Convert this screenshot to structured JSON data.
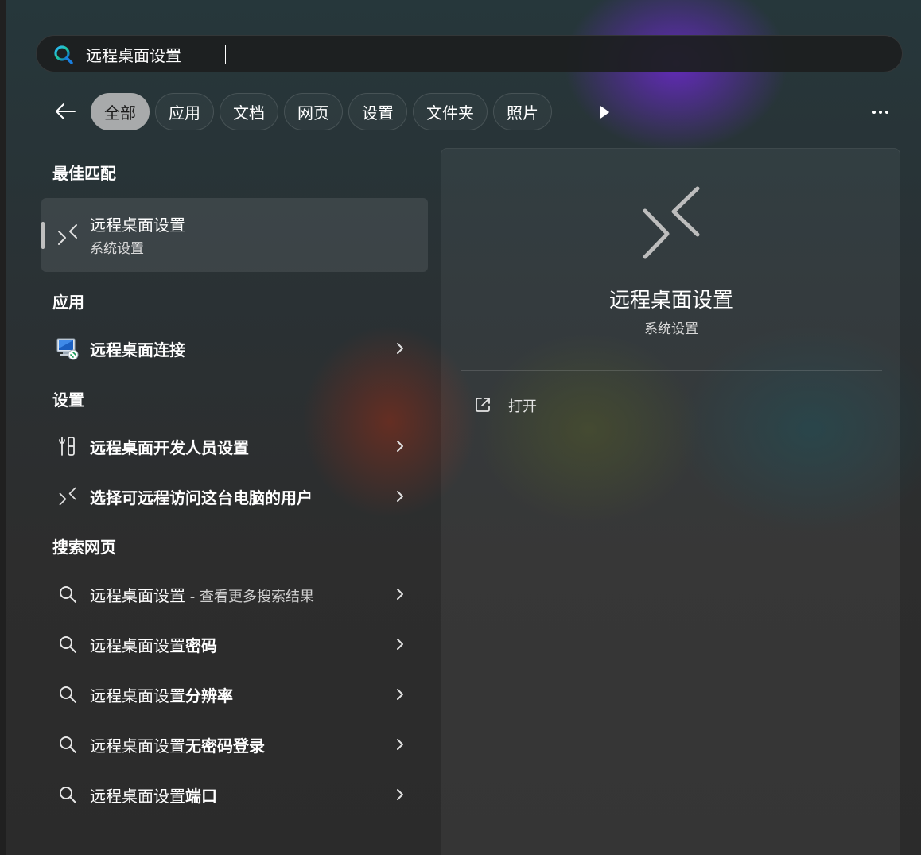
{
  "search": {
    "value": "远程桌面设置",
    "icon": "search-icon"
  },
  "tabs": [
    {
      "label": "全部",
      "active": true
    },
    {
      "label": "应用"
    },
    {
      "label": "文档"
    },
    {
      "label": "网页"
    },
    {
      "label": "设置"
    },
    {
      "label": "文件夹"
    },
    {
      "label": "照片"
    }
  ],
  "nav": {
    "back_icon": "arrow-left-icon",
    "more_tabs_icon": "play-icon",
    "more_icon": "ellipsis-icon"
  },
  "sections": {
    "best_match": "最佳匹配",
    "apps": "应用",
    "settings": "设置",
    "web": "搜索网页"
  },
  "best_match": {
    "title": "远程桌面设置",
    "subtitle": "系统设置",
    "icon": "remote-desktop-icon"
  },
  "apps": [
    {
      "label": "远程桌面连接",
      "icon": "remote-desktop-connection-icon"
    }
  ],
  "settings": [
    {
      "label": "远程桌面开发人员设置",
      "icon": "developer-tools-icon"
    },
    {
      "label": "选择可远程访问这台电脑的用户",
      "icon": "remote-desktop-icon"
    }
  ],
  "web": [
    {
      "prefix": "远程桌面设置",
      "suffix": " - 查看更多搜索结果"
    },
    {
      "prefix": "远程桌面设置",
      "suffix": "密码"
    },
    {
      "prefix": "远程桌面设置",
      "suffix": "分辨率"
    },
    {
      "prefix": "远程桌面设置",
      "suffix": "无密码登录"
    },
    {
      "prefix": "远程桌面设置",
      "suffix": "端口"
    }
  ],
  "preview": {
    "title": "远程桌面设置",
    "subtitle": "系统设置",
    "action_open": "打开",
    "action_icon": "open-external-icon"
  }
}
